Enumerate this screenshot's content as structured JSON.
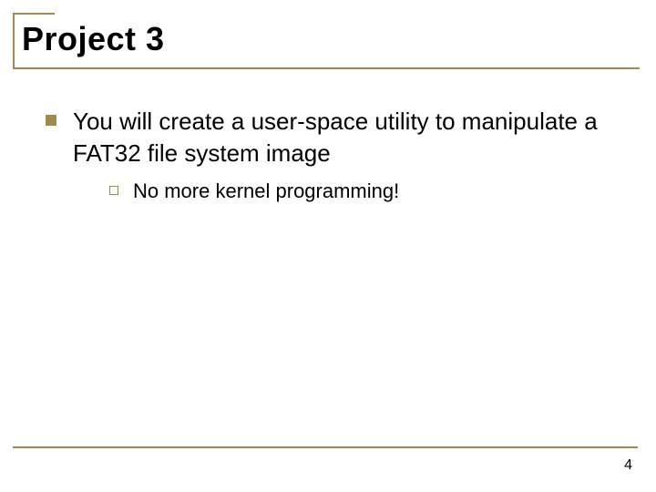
{
  "slide": {
    "title": "Project 3",
    "bullets": [
      {
        "text": "You will create a user-space utility to manipulate a FAT32 file system image",
        "sub": [
          {
            "text": "No more kernel programming!"
          }
        ]
      }
    ],
    "page_number": "4"
  },
  "colors": {
    "accent": "#a18a4f"
  }
}
